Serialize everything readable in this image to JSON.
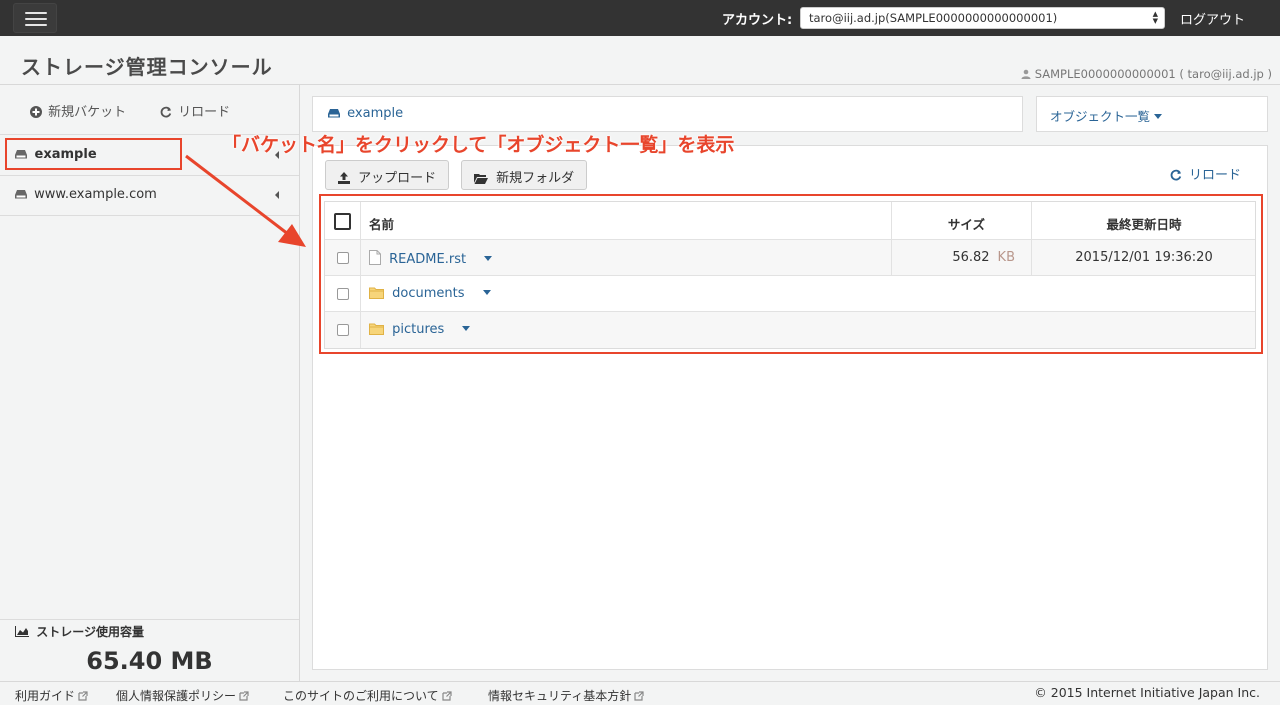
{
  "topbar": {
    "account_label": "アカウント:",
    "account_value": "taro@iij.ad.jp(SAMPLE0000000000000001)",
    "logout": "ログアウト"
  },
  "header": {
    "title": "ストレージ管理コンソール",
    "user_info": "SAMPLE0000000000001 ( taro@iij.ad.jp )"
  },
  "sidebar": {
    "new_bucket": "新規バケット",
    "reload": "リロード",
    "buckets": [
      {
        "name": "example",
        "active": true
      },
      {
        "name": "www.example.com",
        "active": false
      }
    ],
    "usage_label": "ストレージ使用容量",
    "usage_value": "65.40 MB"
  },
  "main": {
    "breadcrumb": "example",
    "view_menu": "オブジェクト一覧",
    "annotation": "「バケット名」をクリックして「オブジェクト一覧」を表示",
    "upload": "アップロード",
    "new_folder": "新規フォルダ",
    "reload": "リロード",
    "table": {
      "headers": {
        "name": "名前",
        "size": "サイズ",
        "modified": "最終更新日時"
      },
      "rows": [
        {
          "type": "file",
          "name": "README.rst",
          "size": "56.82",
          "unit": "KB",
          "modified": "2015/12/01 19:36:20"
        },
        {
          "type": "folder",
          "name": "documents"
        },
        {
          "type": "folder",
          "name": "pictures"
        }
      ]
    }
  },
  "footer": {
    "links": [
      "利用ガイド",
      "個人情報保護ポリシー",
      "このサイトのご利用について",
      "情報セキュリティ基本方針"
    ],
    "copyright": "© 2015 Internet Initiative Japan Inc."
  },
  "colors": {
    "topbar": "#333333",
    "link": "#2a6496",
    "annotation": "#e8452c",
    "folder": "#f0c14b"
  }
}
